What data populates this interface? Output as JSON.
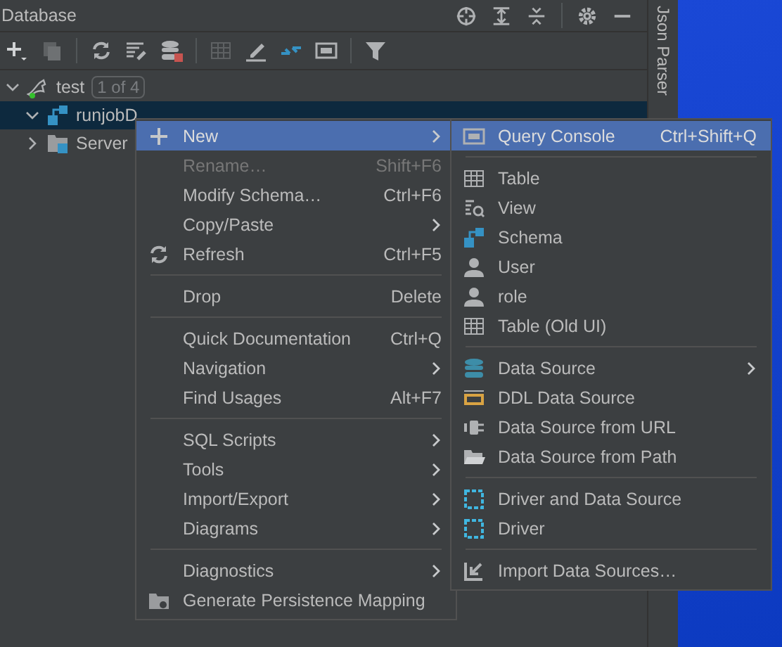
{
  "panel": {
    "title": "Database",
    "side_tab": "Json Parser"
  },
  "tree": [
    {
      "label": "test",
      "badge": "1 of 4",
      "expanded": true,
      "selected": false,
      "children": [
        {
          "label": "runjobD",
          "expanded": true,
          "selected": true
        },
        {
          "label": "Server",
          "expanded": false,
          "selected": false
        }
      ]
    }
  ],
  "context_menu": {
    "groups": [
      [
        {
          "label": "New",
          "submenu": true,
          "disabled": false,
          "selected": true
        },
        {
          "label": "Rename…",
          "shortcut": "Shift+F6",
          "submenu": false,
          "disabled": true,
          "selected": false
        },
        {
          "label": "Modify Schema…",
          "shortcut": "Ctrl+F6",
          "submenu": false,
          "disabled": false,
          "selected": false
        },
        {
          "label": "Copy/Paste",
          "submenu": true,
          "disabled": false,
          "selected": false
        },
        {
          "label": "Refresh",
          "shortcut": "Ctrl+F5",
          "submenu": false,
          "disabled": false,
          "selected": false
        }
      ],
      [
        {
          "label": "Drop",
          "shortcut": "Delete",
          "submenu": false,
          "disabled": false,
          "selected": false
        }
      ],
      [
        {
          "label": "Quick Documentation",
          "shortcut": "Ctrl+Q",
          "submenu": false,
          "disabled": false,
          "selected": false
        },
        {
          "label": "Navigation",
          "submenu": true,
          "disabled": false,
          "selected": false
        },
        {
          "label": "Find Usages",
          "shortcut": "Alt+F7",
          "submenu": false,
          "disabled": false,
          "selected": false
        }
      ],
      [
        {
          "label": "SQL Scripts",
          "submenu": true,
          "disabled": false,
          "selected": false
        },
        {
          "label": "Tools",
          "submenu": true,
          "disabled": false,
          "selected": false
        },
        {
          "label": "Import/Export",
          "submenu": true,
          "disabled": false,
          "selected": false
        },
        {
          "label": "Diagrams",
          "submenu": true,
          "disabled": false,
          "selected": false
        }
      ],
      [
        {
          "label": "Diagnostics",
          "submenu": true,
          "disabled": false,
          "selected": false
        },
        {
          "label": "Generate Persistence Mapping",
          "submenu": false,
          "disabled": false,
          "selected": false
        }
      ]
    ]
  },
  "submenu": {
    "groups": [
      [
        {
          "label": "Query Console",
          "shortcut": "Ctrl+Shift+Q",
          "submenu": false,
          "disabled": false,
          "selected": true
        }
      ],
      [
        {
          "label": "Table",
          "submenu": false,
          "disabled": false,
          "selected": false
        },
        {
          "label": "View",
          "submenu": false,
          "disabled": false,
          "selected": false
        },
        {
          "label": "Schema",
          "submenu": false,
          "disabled": false,
          "selected": false
        },
        {
          "label": "User",
          "submenu": false,
          "disabled": false,
          "selected": false
        },
        {
          "label": "role",
          "submenu": false,
          "disabled": false,
          "selected": false
        },
        {
          "label": "Table (Old UI)",
          "submenu": false,
          "disabled": false,
          "selected": false
        }
      ],
      [
        {
          "label": "Data Source",
          "submenu": true,
          "disabled": false,
          "selected": false
        },
        {
          "label": "DDL Data Source",
          "submenu": false,
          "disabled": false,
          "selected": false
        },
        {
          "label": "Data Source from URL",
          "submenu": false,
          "disabled": false,
          "selected": false
        },
        {
          "label": "Data Source from Path",
          "submenu": false,
          "disabled": false,
          "selected": false
        }
      ],
      [
        {
          "label": "Driver and Data Source",
          "submenu": false,
          "disabled": false,
          "selected": false
        },
        {
          "label": "Driver",
          "submenu": false,
          "disabled": false,
          "selected": false
        }
      ],
      [
        {
          "label": "Import Data Sources…",
          "submenu": false,
          "disabled": false,
          "selected": false
        }
      ]
    ]
  }
}
